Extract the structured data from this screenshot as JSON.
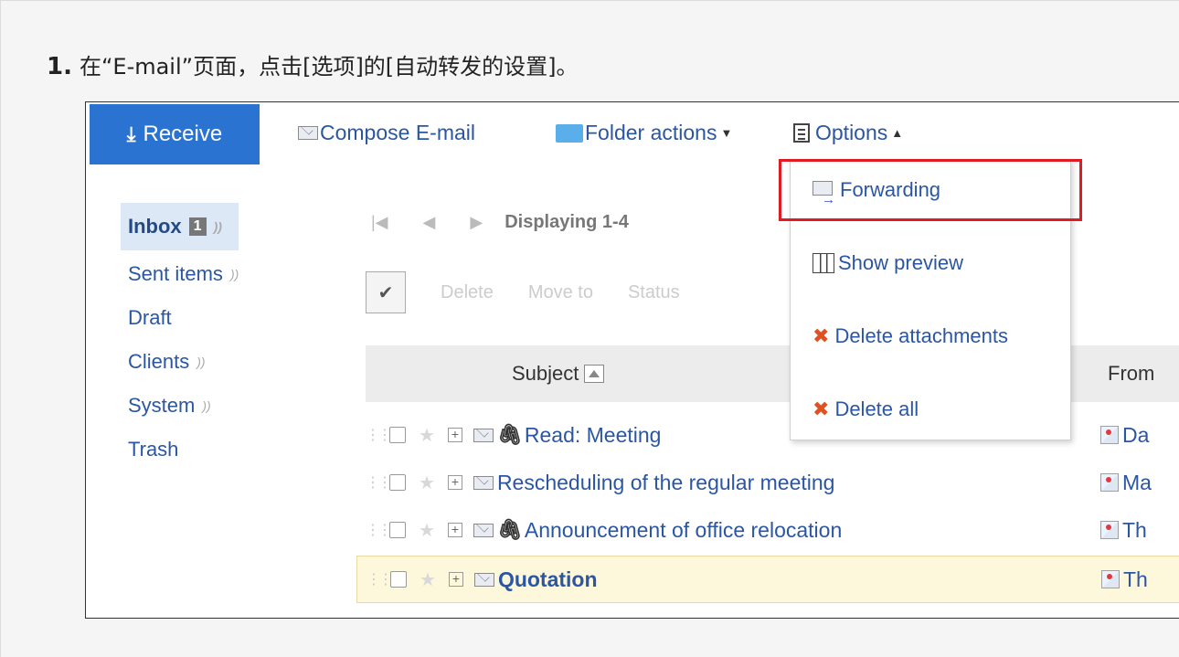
{
  "step": {
    "number": "1.",
    "text": "在“E-mail”页面，点击[选项]的[自动转发的设置]。"
  },
  "toolbar": {
    "receive_label": "Receive",
    "receive_icon": "download-icon",
    "compose_label": "Compose E-mail",
    "folder_actions_label": "Folder actions",
    "options_label": "Options"
  },
  "folders": {
    "inbox": "Inbox",
    "inbox_badge": "1",
    "sent": "Sent items",
    "draft": "Draft",
    "clients": "Clients",
    "system": "System",
    "trash": "Trash"
  },
  "pager": {
    "first": "|◀",
    "prev": "◀",
    "next": "▶",
    "displaying": "Displaying 1-4"
  },
  "actions": {
    "delete": "Delete",
    "move_to": "Move to",
    "status": "Status"
  },
  "list": {
    "col_subject": "Subject",
    "col_from": "From",
    "rows": [
      {
        "subject": "Read: Meeting",
        "from": "Da",
        "attachment": true,
        "bold": false
      },
      {
        "subject": "Rescheduling of the regular meeting",
        "from": "Ma",
        "attachment": false,
        "bold": false
      },
      {
        "subject": "Announcement of office relocation",
        "from": "Th",
        "attachment": true,
        "bold": false
      },
      {
        "subject": "Quotation",
        "from": "Th",
        "attachment": false,
        "bold": true
      }
    ]
  },
  "options_menu": {
    "forwarding": "Forwarding",
    "show_preview": "Show preview",
    "delete_attachments": "Delete attachments",
    "delete_all": "Delete all"
  },
  "colors": {
    "receive_button": "#2a73d1",
    "link": "#2b56a2",
    "highlight_box": "#e01b24",
    "selected_row": "#fdf7dc"
  }
}
